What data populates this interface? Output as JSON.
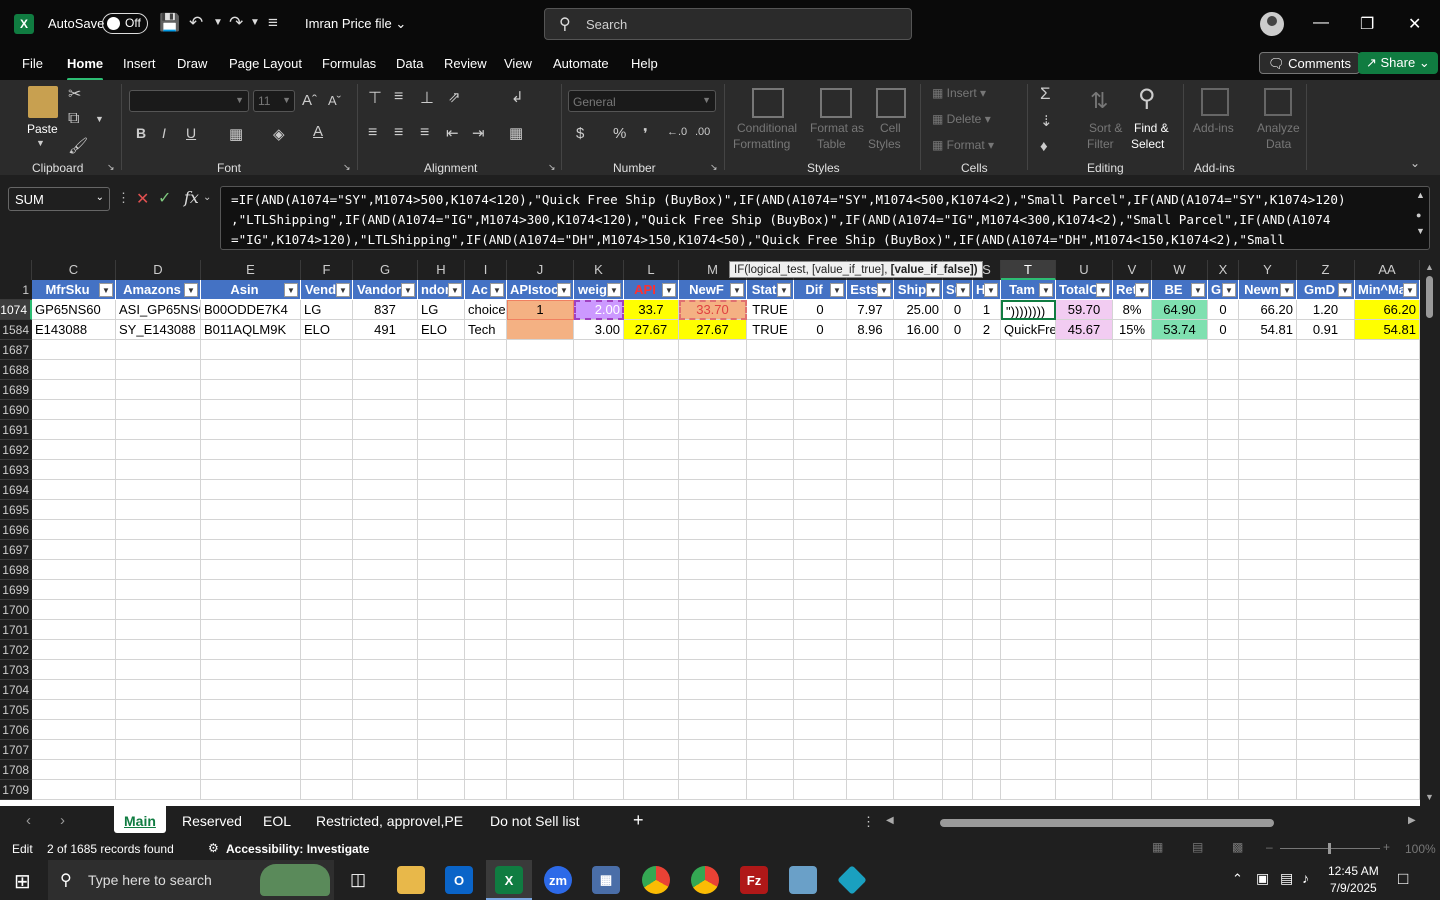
{
  "titlebar": {
    "app_icon": "X",
    "autosave_label": "AutoSave",
    "autosave_state": "Off",
    "filename": "Imran Price file",
    "search_placeholder": "Search"
  },
  "menu": [
    "File",
    "Home",
    "Insert",
    "Draw",
    "Page Layout",
    "Formulas",
    "Data",
    "Review",
    "View",
    "Automate",
    "Help"
  ],
  "menu_active": "Home",
  "header_buttons": {
    "comments": "Comments",
    "share": "Share"
  },
  "ribbon": {
    "clipboard": {
      "label": "Clipboard",
      "paste": "Paste"
    },
    "font": {
      "label": "Font",
      "size": "11"
    },
    "alignment": {
      "label": "Alignment"
    },
    "number": {
      "label": "Number",
      "format": "General"
    },
    "styles": {
      "label": "Styles",
      "conditional": "Conditional",
      "conditional2": "Formatting",
      "format_as": "Format as",
      "format_as2": "Table",
      "cell": "Cell",
      "cell2": "Styles"
    },
    "cells": {
      "label": "Cells",
      "insert": "Insert",
      "delete": "Delete",
      "format": "Format"
    },
    "editing": {
      "label": "Editing",
      "sort": "Sort &",
      "sort2": "Filter",
      "find": "Find &",
      "find2": "Select"
    },
    "addins": {
      "label": "Add-ins",
      "addins": "Add-ins",
      "analyze": "Analyze",
      "analyze2": "Data"
    }
  },
  "namebox": "SUM",
  "formula_lines": [
    "=IF(AND(A1074=\"SY\",M1074>500,K1074<120),\"Quick Free Ship (BuyBox)\",IF(AND(A1074=\"SY\",M1074<500,K1074<2),\"Small Parcel\",IF(AND(A1074=\"SY\",K1074>120)",
    ",\"LTLShipping\",IF(AND(A1074=\"IG\",M1074>300,K1074<120),\"Quick Free Ship (BuyBox)\",IF(AND(A1074=\"IG\",M1074<300,K1074<2),\"Small Parcel\",IF(AND(A1074",
    "=\"IG\",K1074>120),\"LTLShipping\",IF(AND(A1074=\"DH\",M1074>150,K1074<50),\"Quick Free Ship (BuyBox)\",IF(AND(A1074=\"DH\",M1074<150,K1074<2),\"Small"
  ],
  "tooltip": {
    "text": "IF(logical_test, [value_if_true], ",
    "bold": "[value_if_false])"
  },
  "columns": [
    "C",
    "D",
    "E",
    "F",
    "G",
    "H",
    "I",
    "J",
    "K",
    "L",
    "M",
    "N",
    "O",
    "P",
    "Q",
    "R",
    "S",
    "T",
    "U",
    "V",
    "W",
    "X",
    "Y",
    "Z",
    "AA"
  ],
  "header_row": [
    "MfrSku",
    "Amazons",
    "Asin",
    "Vend",
    "Vandor",
    "ndor",
    "Ac",
    "APIstoc",
    "weig",
    "API",
    "NewF",
    "Stat",
    "Dif",
    "Ests",
    "Ship",
    "Su",
    "H",
    "Tam",
    "TotalC",
    "Ret",
    "BE",
    "Gl",
    "Newn",
    "GmD",
    "Min^Ma"
  ],
  "rows": [
    {
      "num": "1074",
      "cells": [
        "GP65NS60",
        "ASI_GP65NS6",
        "B00ODDE7K4",
        "LG",
        "837",
        "LG",
        "choice",
        "1",
        "2.00",
        "33.7",
        "33.70",
        "TRUE",
        "0",
        "7.97",
        "25.00",
        "0",
        "1",
        "\"))))))))",
        "59.70",
        "8%",
        "64.90",
        "0",
        "66.20",
        "1.20",
        "66.20"
      ]
    },
    {
      "num": "1584",
      "cells": [
        "E143088",
        "SY_E143088",
        "B011AQLM9K",
        "ELO",
        "491",
        "ELO",
        "Tech",
        "",
        "3.00",
        "27.67",
        "27.67",
        "TRUE",
        "0",
        "8.96",
        "16.00",
        "0",
        "2",
        "QuickFre",
        "45.67",
        "15%",
        "53.74",
        "0",
        "54.81",
        "0.91",
        "54.81"
      ]
    }
  ],
  "empty_rows": [
    "1687",
    "1688",
    "1689",
    "1690",
    "1691",
    "1692",
    "1693",
    "1694",
    "1695",
    "1696",
    "1697",
    "1698",
    "1699",
    "1700",
    "1701",
    "1702",
    "1703",
    "1704",
    "1705",
    "1706",
    "1707",
    "1708",
    "1709"
  ],
  "sheet_tabs": [
    "Main",
    "Reserved",
    "EOL",
    "Restricted, approvel,PE",
    "Do not Sell list"
  ],
  "status": {
    "mode": "Edit",
    "records": "2 of 1685 records found",
    "accessibility": "Accessibility: Investigate",
    "zoom": "100%"
  },
  "taskbar": {
    "search": "Type here to search",
    "time": "12:45 AM",
    "date": "7/9/2025"
  },
  "colors": {
    "header_blue": "#4472c4",
    "yellow": "#ffff00",
    "orange": "#f4b183",
    "purple": "#cc99ff",
    "pink": "#f2ccf2",
    "green": "#7fe0b0",
    "accent": "#107c41"
  }
}
